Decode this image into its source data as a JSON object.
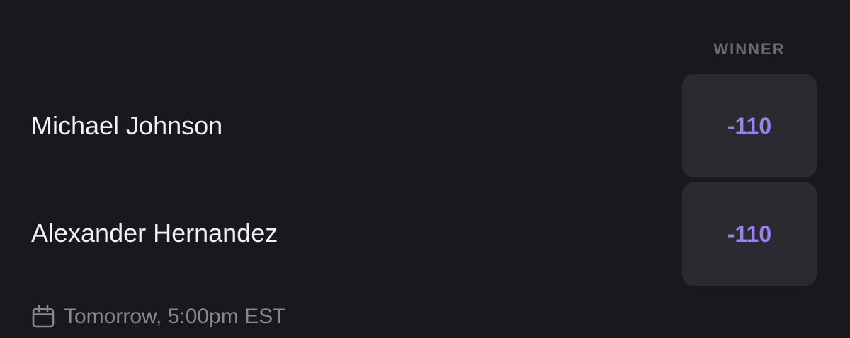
{
  "market": {
    "header": "WINNER"
  },
  "competitors": [
    {
      "name": "Michael Johnson",
      "odds": "-110"
    },
    {
      "name": "Alexander Hernandez",
      "odds": "-110"
    }
  ],
  "event": {
    "time": "Tomorrow, 5:00pm EST",
    "icon": "calendar-icon"
  },
  "colors": {
    "background": "#19181c",
    "odds_button": "#2b2a31",
    "odds_text": "#9a80f2",
    "name_text": "#f1f0f4",
    "muted_text": "#8a8794"
  }
}
